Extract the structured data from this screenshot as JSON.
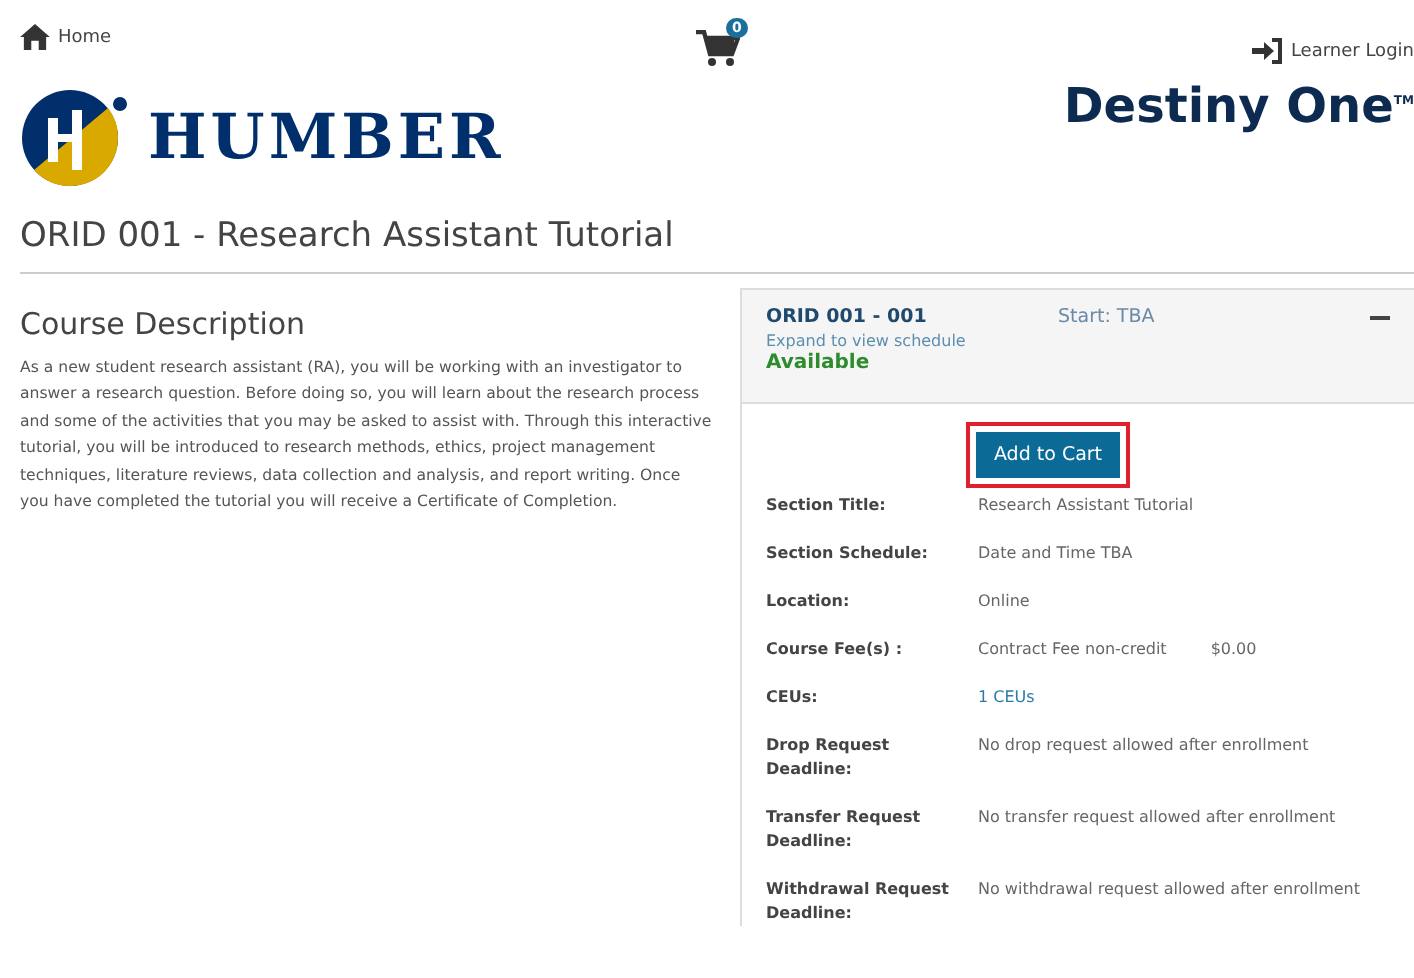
{
  "nav": {
    "home": "Home",
    "cart_count": "0",
    "login": "Learner Login"
  },
  "brand": {
    "logo_text": "HUMBER",
    "product": "Destiny One$^{TM}$"
  },
  "course_title": "ORID 001 - Research Assistant Tutorial",
  "description": {
    "heading": "Course Description",
    "text": "As a new student research assistant (RA), you will be working with an investigator to answer a research question. Before doing so, you will learn about the research process and some of the activities that you may be asked to assist with. Through this interactive tutorial, you will be introduced to research methods, ethics, project management techniques, literature reviews, data collection and analysis, and report writing. Once you have completed the tutorial you will receive a Certificate of Completion."
  },
  "section": {
    "code": "ORID 001 - 001",
    "start": "Start: TBA",
    "expand_hint": "Expand to view schedule",
    "availability": "Available",
    "expanded": true,
    "button": {
      "label": "Add to Cart",
      "highlighted": true
    },
    "details": [
      {
        "label": "Section Title:",
        "kind": "text",
        "values": [
          "Research Assistant Tutorial"
        ]
      },
      {
        "label": "Section Schedule:",
        "kind": "text",
        "values": [
          "Date and Time TBA"
        ]
      },
      {
        "label": "Location:",
        "kind": "text",
        "values": [
          "Online"
        ]
      },
      {
        "label": "Course Fee(s) :",
        "kind": "text",
        "values": [
          "Contract Fee non-credit",
          "$0.00"
        ]
      },
      {
        "label": "CEUs:",
        "kind": "link",
        "values": [
          "1 CEUs"
        ]
      },
      {
        "label": "Drop Request Deadline:",
        "kind": "text",
        "values": [
          "No drop request allowed after enrollment"
        ]
      },
      {
        "label": "Transfer Request Deadline:",
        "kind": "text",
        "values": [
          "No transfer request allowed after enrollment"
        ]
      },
      {
        "label": "Withdrawal Request Deadline:",
        "kind": "text",
        "values": [
          "No withdrawal request allowed after enrollment"
        ]
      }
    ]
  }
}
